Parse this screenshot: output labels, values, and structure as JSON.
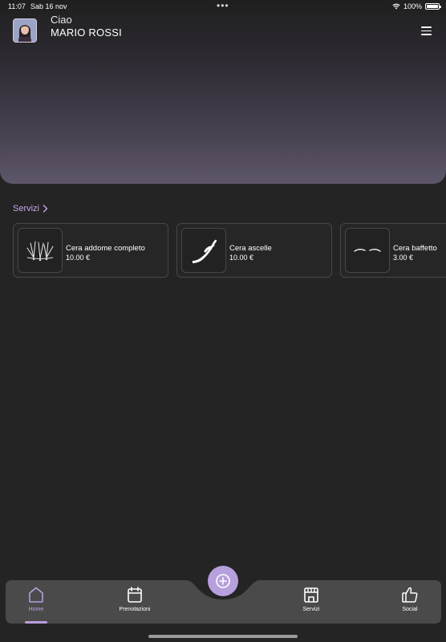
{
  "status_bar": {
    "time": "11:07",
    "date": "Sab 16 nov",
    "battery": "100%",
    "battery_level": 1.0
  },
  "header": {
    "greeting": "Ciao",
    "user_name": "MARIO ROSSI"
  },
  "services_section": {
    "title": "Servizi",
    "items": [
      {
        "name": "Cera addome completo",
        "price": "10.00 €",
        "icon": "hair-growth-icon"
      },
      {
        "name": "Cera ascelle",
        "price": "10.00 €",
        "icon": "arm-icon"
      },
      {
        "name": "Cera baffetto",
        "price": "3.00 €",
        "icon": "eyebrows-icon"
      }
    ]
  },
  "tab_bar": {
    "tabs": [
      {
        "label": "Home",
        "icon": "home-icon",
        "active": true
      },
      {
        "label": "Prenotazioni",
        "icon": "calendar-icon",
        "active": false
      },
      {
        "label": "Servizi",
        "icon": "shop-icon",
        "active": false
      },
      {
        "label": "Social",
        "icon": "thumbs-up-icon",
        "active": false
      }
    ],
    "fab_icon": "plus-circle-icon"
  },
  "colors": {
    "accent": "#b7a0de",
    "link": "#c3a8e6",
    "background": "#242424",
    "card_border": "#474747"
  }
}
